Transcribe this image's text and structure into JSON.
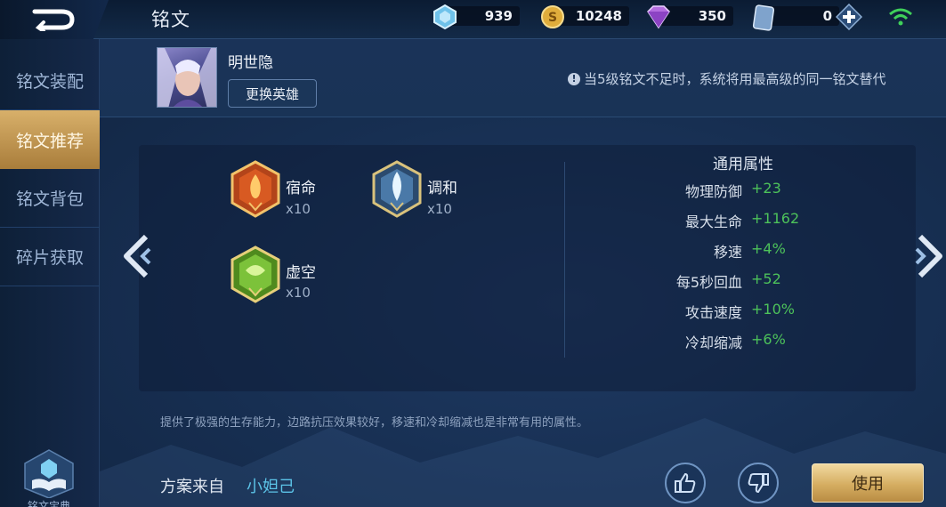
{
  "header": {
    "title": "铭文",
    "back_icon": "back-arrow-icon",
    "currencies": [
      {
        "name": "diamond",
        "icon": "diamond-icon",
        "value": "939"
      },
      {
        "name": "gold",
        "icon": "gold-coin-icon",
        "value": "10248"
      },
      {
        "name": "gem",
        "icon": "gem-icon",
        "value": "350"
      },
      {
        "name": "card",
        "icon": "card-icon",
        "value": "0"
      }
    ],
    "add_icon": "plus-icon",
    "wifi_icon": "wifi-icon"
  },
  "sidebar": {
    "items": [
      {
        "label": "铭文装配",
        "active": false
      },
      {
        "label": "铭文推荐",
        "active": true
      },
      {
        "label": "铭文背包",
        "active": false
      },
      {
        "label": "碎片获取",
        "active": false
      }
    ],
    "bottom_label": "铭文宝典"
  },
  "hero": {
    "name": "明世隐",
    "change_button": "更换英雄",
    "notice": "当5级铭文不足时，系统将用最高级的同一铭文替代"
  },
  "runes": [
    {
      "name": "宿命",
      "count": "x10",
      "color": "#d2521f",
      "icon": "red-rune-icon"
    },
    {
      "name": "调和",
      "count": "x10",
      "color": "#7fb4d8",
      "icon": "blue-rune-icon"
    },
    {
      "name": "虚空",
      "count": "x10",
      "color": "#6fb12c",
      "icon": "green-rune-icon"
    }
  ],
  "attributes": {
    "title": "通用属性",
    "rows": [
      {
        "label": "物理防御",
        "value": "+23"
      },
      {
        "label": "最大生命",
        "value": "+1162"
      },
      {
        "label": "移速",
        "value": "+4%"
      },
      {
        "label": "每5秒回血",
        "value": "+52"
      },
      {
        "label": "攻击速度",
        "value": "+10%"
      },
      {
        "label": "冷却缩减",
        "value": "+6%"
      }
    ]
  },
  "description": "提供了极强的生存能力，边路抗压效果较好，移速和冷却缩减也是非常有用的属性。",
  "footer": {
    "source_label": "方案来自",
    "source_author": "小妲己",
    "like_icon": "thumbs-up-icon",
    "dislike_icon": "thumbs-down-icon",
    "use_button": "使用"
  },
  "colors": {
    "accent_gold": "#d5ad61",
    "positive": "#4dc25a",
    "link": "#5cc4e8"
  }
}
